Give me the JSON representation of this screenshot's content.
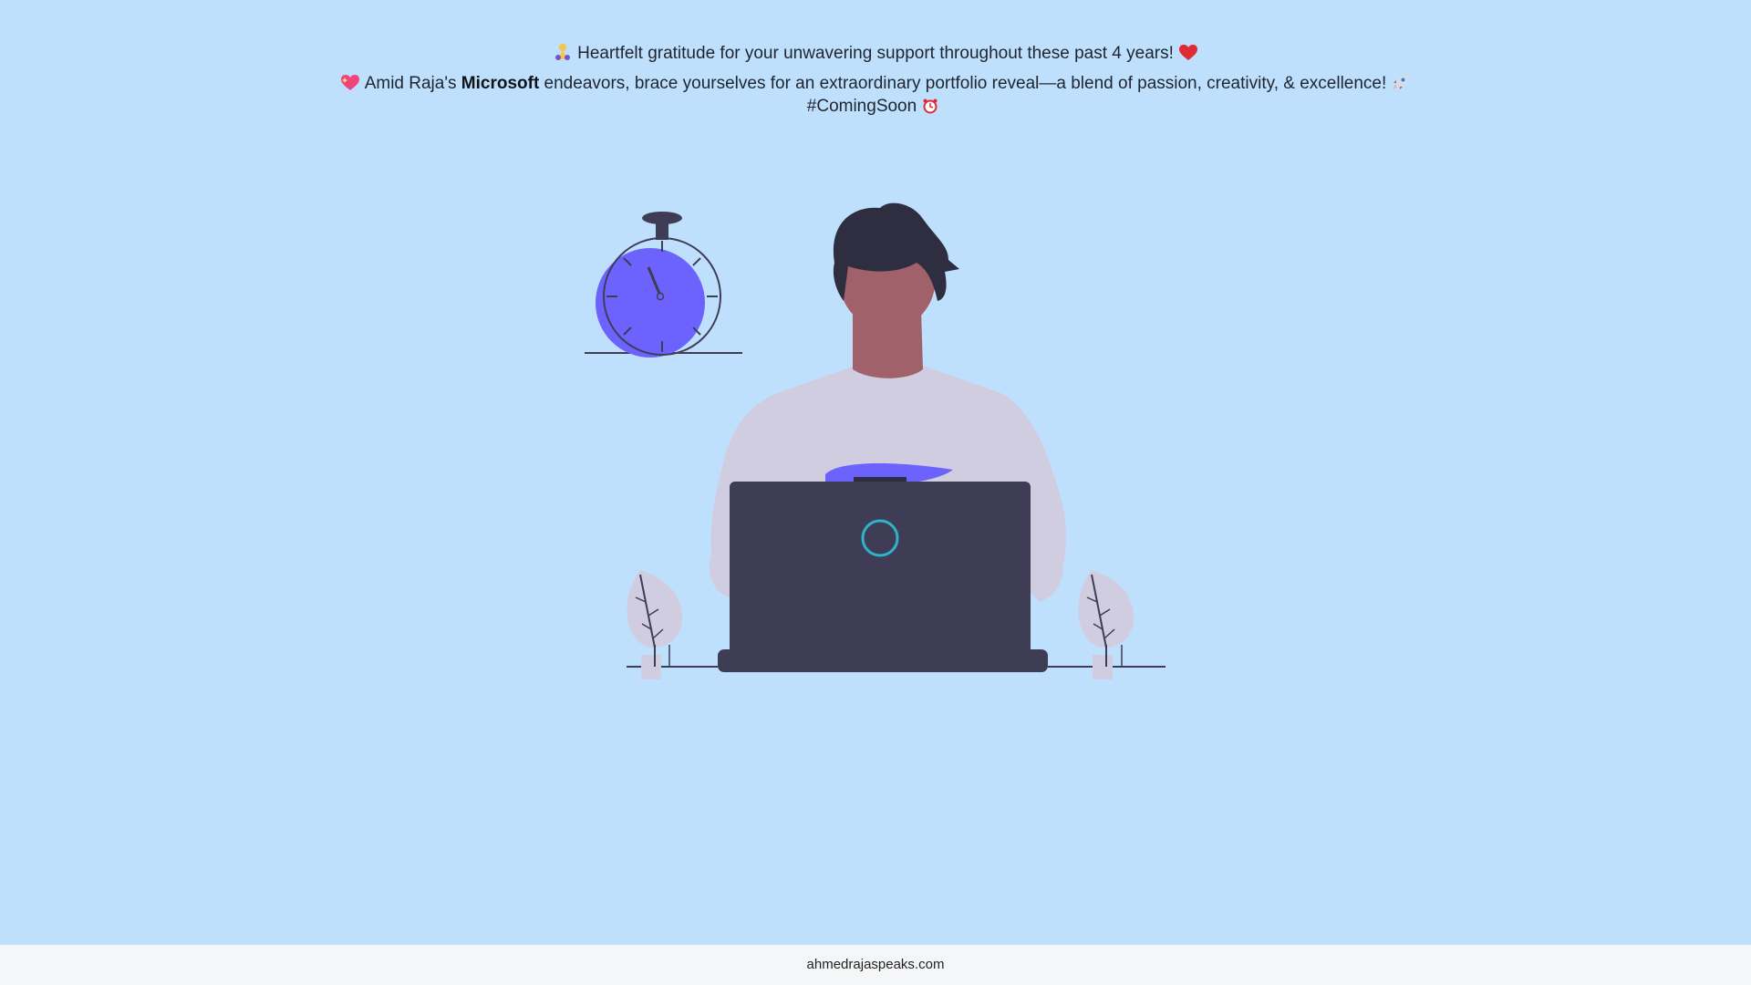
{
  "message": {
    "line1": {
      "lead_icon": "praying-hands-icon",
      "text": "Heartfelt gratitude for your unwavering support throughout these past 4 years!",
      "trail_icon": "red-heart-icon"
    },
    "line2": {
      "lead_icon": "sparkling-heart-icon",
      "prefix": "Amid Raja's",
      "bold": "Microsoft",
      "suffix": "endeavors, brace yourselves for an extraordinary portfolio reveal—a blend of passion, creativity, & excellence!",
      "trail_icon": "rocket-icon"
    },
    "line3": {
      "text": "#ComingSoon",
      "trail_icon": "alarm-clock-icon"
    }
  },
  "footer": {
    "link_text": "ahmedrajaspeaks.com"
  },
  "colors": {
    "background": "#bfe0fc",
    "accent_purple": "#6c63ff",
    "dark": "#3f3d56",
    "shirt": "#d0cde1",
    "skin": "#a0616a",
    "laptop_logo": "#2fb3c8"
  }
}
